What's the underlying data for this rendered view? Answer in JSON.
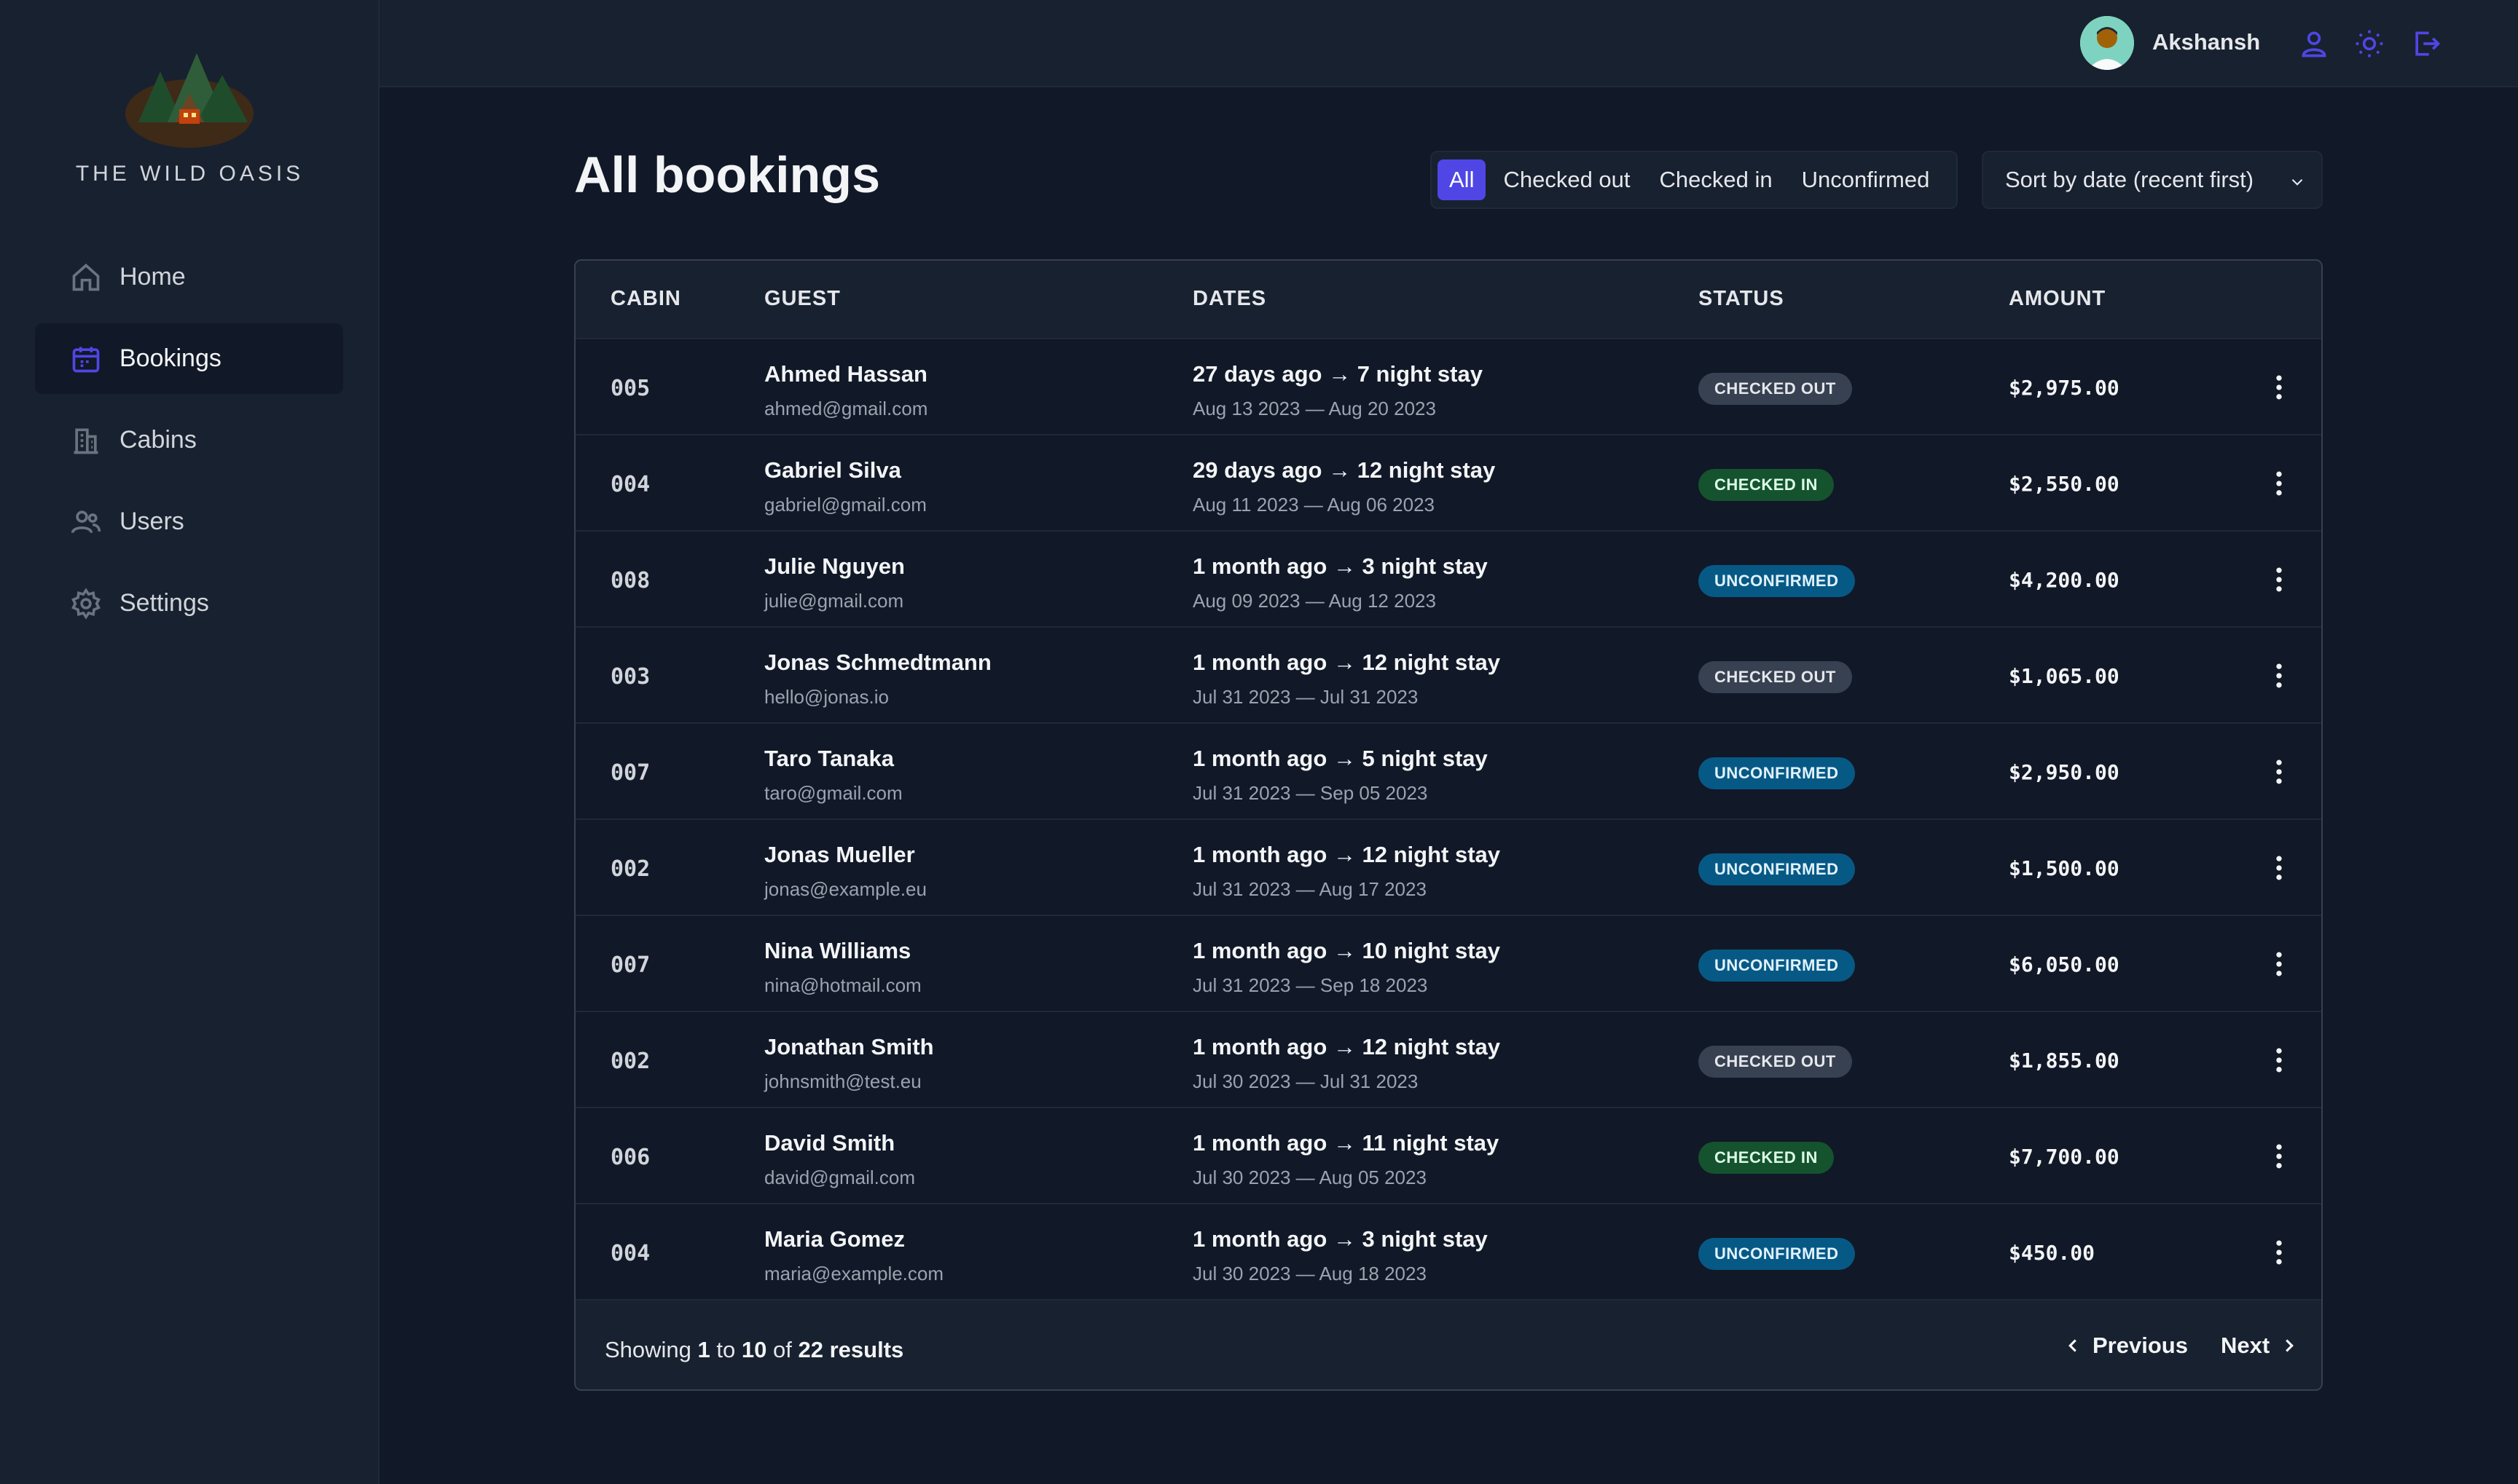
{
  "brand": {
    "name": "THE WILD OASIS"
  },
  "sidebar": {
    "items": [
      {
        "label": "Home",
        "icon": "home-icon"
      },
      {
        "label": "Bookings",
        "icon": "calendar-icon",
        "active": true
      },
      {
        "label": "Cabins",
        "icon": "building-icon"
      },
      {
        "label": "Users",
        "icon": "users-icon"
      },
      {
        "label": "Settings",
        "icon": "gear-icon"
      }
    ]
  },
  "header": {
    "user_name": "Akshansh",
    "buttons": [
      "user-icon",
      "sun-icon",
      "logout-icon"
    ]
  },
  "page": {
    "title": "All bookings"
  },
  "filter": {
    "options": [
      "All",
      "Checked out",
      "Checked in",
      "Unconfirmed"
    ],
    "active": "All"
  },
  "sort": {
    "selected": "Sort by date (recent first)"
  },
  "table": {
    "headers": [
      "CABIN",
      "GUEST",
      "DATES",
      "STATUS",
      "AMOUNT"
    ],
    "rows": [
      {
        "cabin": "005",
        "name": "Ahmed Hassan",
        "email": "ahmed@gmail.com",
        "stay": "27 days ago → 7 night stay",
        "range": "Aug 13 2023 — Aug 20 2023",
        "status": "CHECKED OUT",
        "amount": "$2,975.00"
      },
      {
        "cabin": "004",
        "name": "Gabriel Silva",
        "email": "gabriel@gmail.com",
        "stay": "29 days ago → 12 night stay",
        "range": "Aug 11 2023 — Aug 06 2023",
        "status": "CHECKED IN",
        "amount": "$2,550.00"
      },
      {
        "cabin": "008",
        "name": "Julie Nguyen",
        "email": "julie@gmail.com",
        "stay": "1 month ago → 3 night stay",
        "range": "Aug 09 2023 — Aug 12 2023",
        "status": "UNCONFIRMED",
        "amount": "$4,200.00"
      },
      {
        "cabin": "003",
        "name": "Jonas Schmedtmann",
        "email": "hello@jonas.io",
        "stay": "1 month ago → 12 night stay",
        "range": "Jul 31 2023 — Jul 31 2023",
        "status": "CHECKED OUT",
        "amount": "$1,065.00"
      },
      {
        "cabin": "007",
        "name": "Taro Tanaka",
        "email": "taro@gmail.com",
        "stay": "1 month ago → 5 night stay",
        "range": "Jul 31 2023 — Sep 05 2023",
        "status": "UNCONFIRMED",
        "amount": "$2,950.00"
      },
      {
        "cabin": "002",
        "name": "Jonas Mueller",
        "email": "jonas@example.eu",
        "stay": "1 month ago → 12 night stay",
        "range": "Jul 31 2023 — Aug 17 2023",
        "status": "UNCONFIRMED",
        "amount": "$1,500.00"
      },
      {
        "cabin": "007",
        "name": "Nina Williams",
        "email": "nina@hotmail.com",
        "stay": "1 month ago → 10 night stay",
        "range": "Jul 31 2023 — Sep 18 2023",
        "status": "UNCONFIRMED",
        "amount": "$6,050.00"
      },
      {
        "cabin": "002",
        "name": "Jonathan Smith",
        "email": "johnsmith@test.eu",
        "stay": "1 month ago → 12 night stay",
        "range": "Jul 30 2023 — Jul 31 2023",
        "status": "CHECKED OUT",
        "amount": "$1,855.00"
      },
      {
        "cabin": "006",
        "name": "David Smith",
        "email": "david@gmail.com",
        "stay": "1 month ago → 11 night stay",
        "range": "Jul 30 2023 — Aug 05 2023",
        "status": "CHECKED IN",
        "amount": "$7,700.00"
      },
      {
        "cabin": "004",
        "name": "Maria Gomez",
        "email": "maria@example.com",
        "stay": "1 month ago → 3 night stay",
        "range": "Jul 30 2023 — Aug 18 2023",
        "status": "UNCONFIRMED",
        "amount": "$450.00"
      }
    ]
  },
  "pagination": {
    "showing_prefix": "Showing",
    "from": "1",
    "to_word": "to",
    "to": "10",
    "of_word": "of",
    "total": "22",
    "results_word": "results",
    "previous": "Previous",
    "next": "Next"
  },
  "colors": {
    "accent": "#4f46e5",
    "checked_out": "#374151",
    "checked_in": "#14532d",
    "unconfirmed": "#075985"
  }
}
